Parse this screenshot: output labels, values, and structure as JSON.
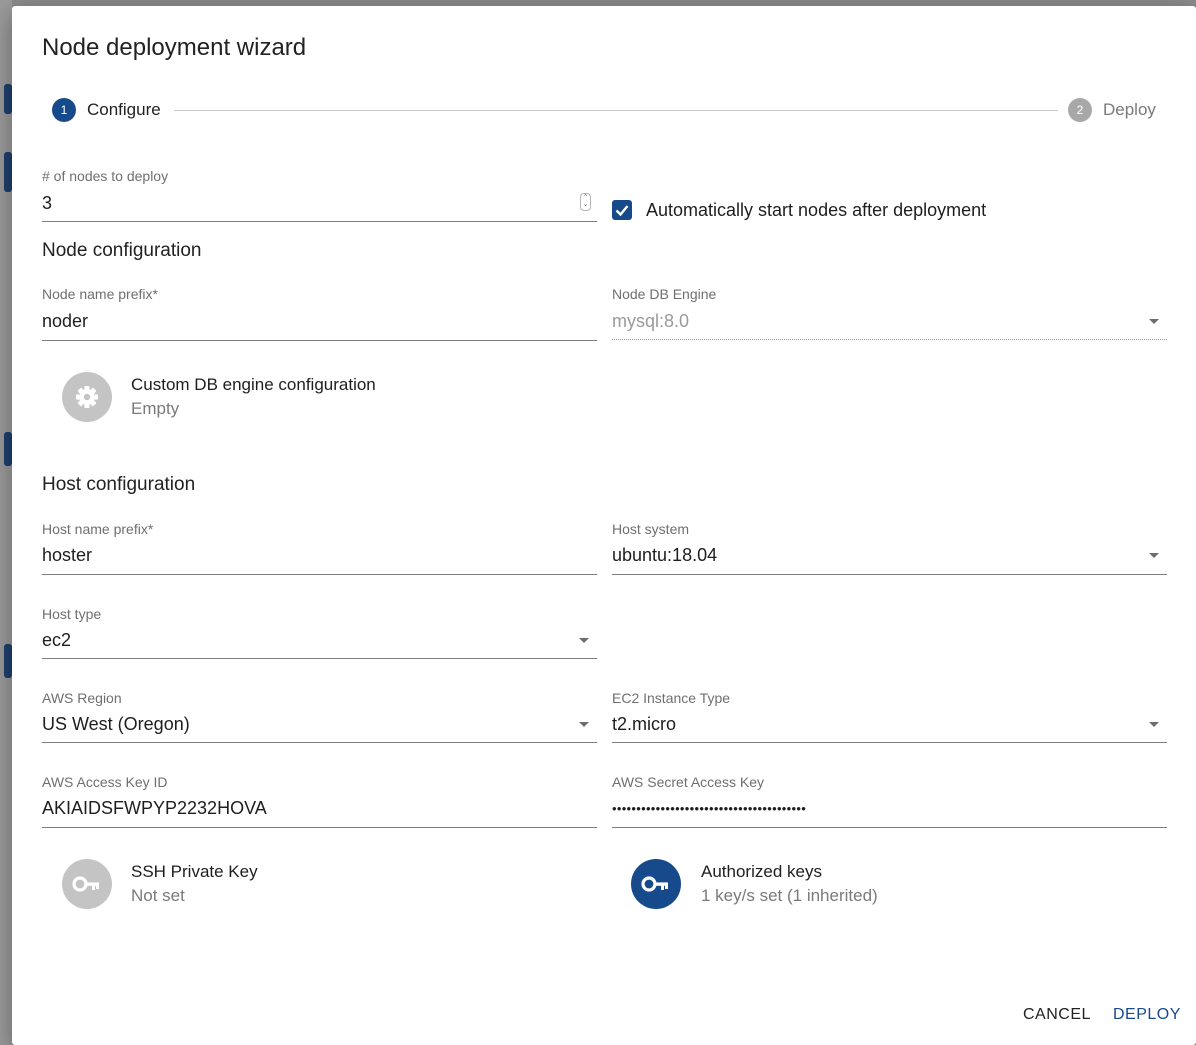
{
  "dialog": {
    "title": "Node deployment wizard"
  },
  "stepper": {
    "steps": [
      {
        "number": "1",
        "label": "Configure",
        "active": true
      },
      {
        "number": "2",
        "label": "Deploy",
        "active": false
      }
    ]
  },
  "nodes_count": {
    "label": "# of nodes to deploy",
    "value": "3"
  },
  "auto_start": {
    "checked": true,
    "label": "Automatically start nodes after deployment"
  },
  "node_config": {
    "section_title": "Node configuration",
    "name_prefix": {
      "label": "Node name prefix",
      "required_mark": "*",
      "value": "noder"
    },
    "db_engine": {
      "label": "Node DB Engine",
      "value": "mysql:8.0"
    },
    "custom_db": {
      "primary": "Custom DB engine configuration",
      "secondary": "Empty",
      "icon": "gear-icon"
    }
  },
  "host_config": {
    "section_title": "Host configuration",
    "name_prefix": {
      "label": "Host name prefix",
      "required_mark": "*",
      "value": "hoster"
    },
    "host_system": {
      "label": "Host system",
      "value": "ubuntu:18.04"
    },
    "host_type": {
      "label": "Host type",
      "value": "ec2"
    },
    "aws_region": {
      "label": "AWS Region",
      "value": "US West (Oregon)"
    },
    "instance_type": {
      "label": "EC2 Instance Type",
      "value": "t2.micro"
    },
    "access_key": {
      "label": "AWS Access Key ID",
      "value": "AKIAIDSFWPYP2232HOVA"
    },
    "secret_key": {
      "label": "AWS Secret Access Key",
      "value": "••••••••••••••••••••••••••••••••••••••••"
    },
    "ssh_key": {
      "primary": "SSH Private Key",
      "secondary": "Not set",
      "icon": "key-icon"
    },
    "authorized_keys": {
      "primary": "Authorized keys",
      "secondary": "1 key/s set (1 inherited)",
      "icon": "key-icon"
    }
  },
  "actions": {
    "cancel": "CANCEL",
    "deploy": "DEPLOY"
  },
  "colors": {
    "primary": "#164a8a",
    "inactive_step": "#a8a8a8",
    "avatar_grey": "#c4c4c4"
  }
}
